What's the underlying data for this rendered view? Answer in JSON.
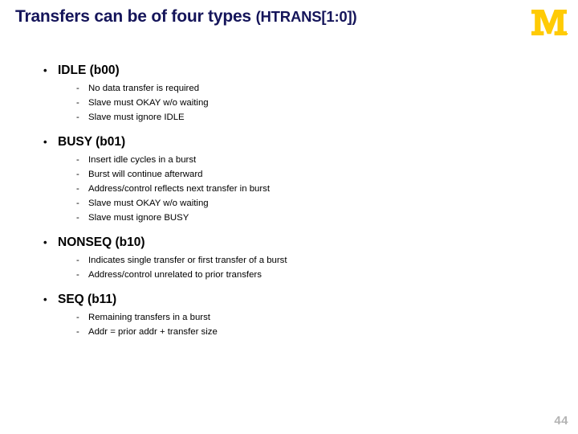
{
  "slide": {
    "title_main": "Transfers can be of four types",
    "title_sub": "(HTRANS[1:0])",
    "title_color": "#15155a",
    "background": "#ffffff",
    "page_number": "44"
  },
  "logo": {
    "name": "university-of-michigan-m",
    "letter": "M",
    "color": "#FFCB05"
  },
  "markers": {
    "level1": "•",
    "level2": "-"
  },
  "bullets": [
    {
      "label": "IDLE (b00)",
      "sub": [
        "No data transfer is required",
        "Slave must OKAY w/o waiting",
        "Slave must ignore IDLE"
      ]
    },
    {
      "label": "BUSY (b01)",
      "sub": [
        "Insert idle cycles in a burst",
        "Burst will continue afterward",
        "Address/control reflects next transfer in burst",
        "Slave must OKAY w/o waiting",
        "Slave must ignore BUSY"
      ]
    },
    {
      "label": "NONSEQ (b10)",
      "sub": [
        "Indicates single transfer or first transfer of a burst",
        "Address/control unrelated to prior transfers"
      ]
    },
    {
      "label": "SEQ (b11)",
      "sub": [
        "Remaining transfers in a burst",
        "Addr = prior addr + transfer size"
      ]
    }
  ]
}
